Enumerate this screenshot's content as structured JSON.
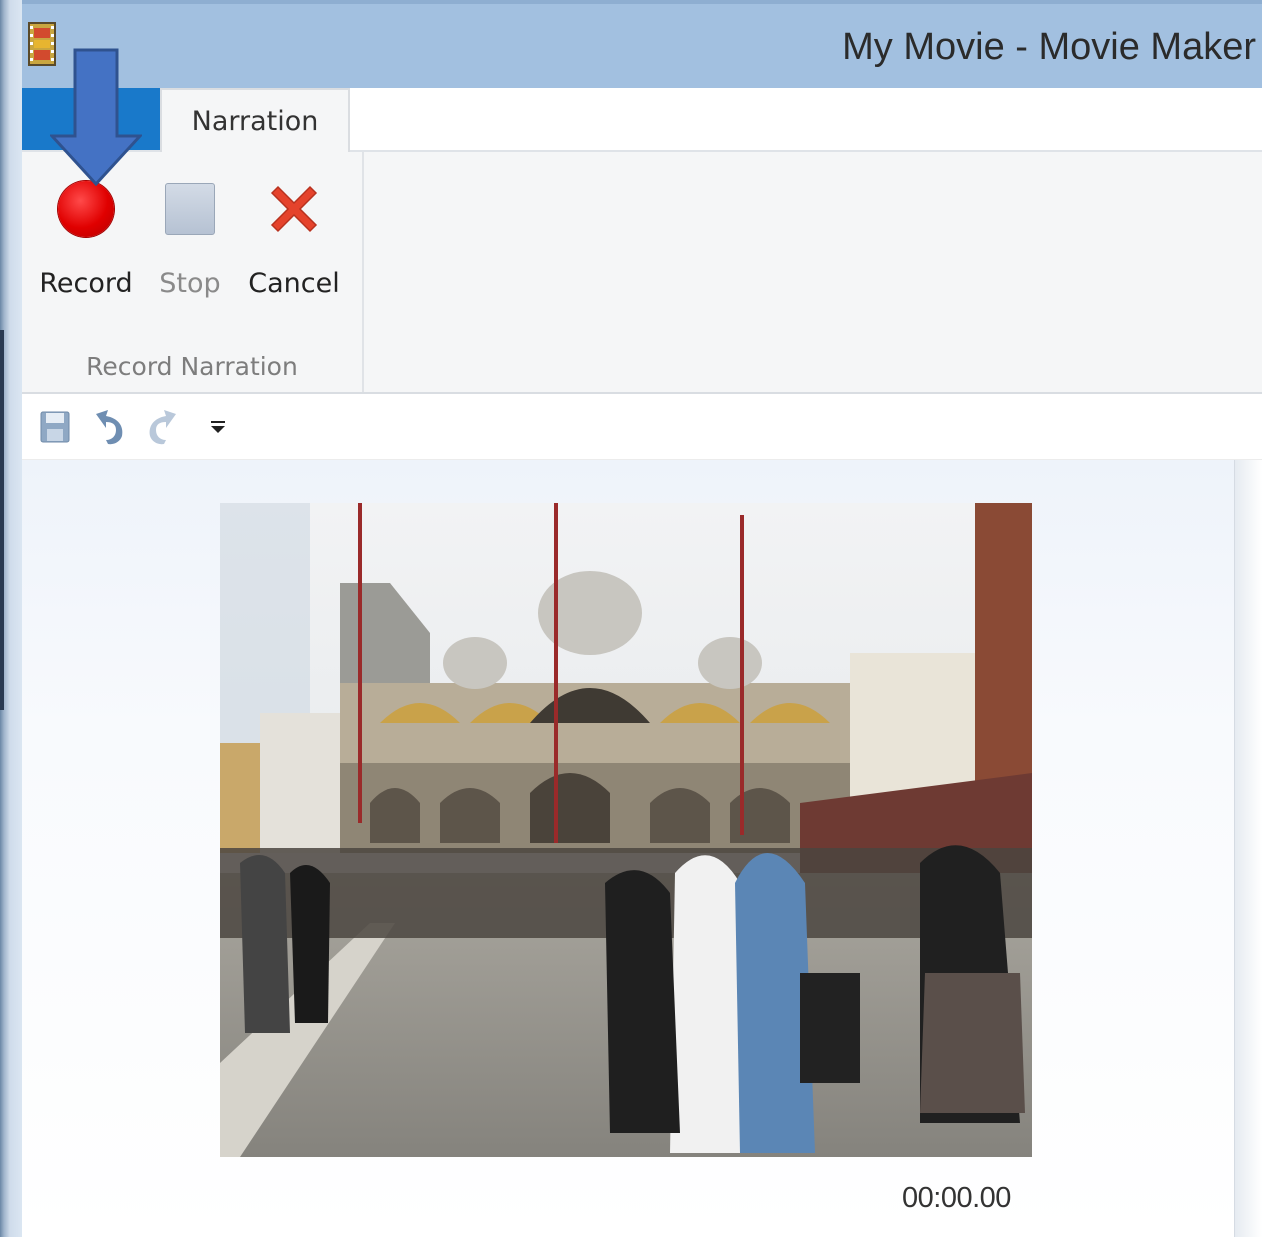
{
  "window": {
    "title": "My Movie - Movie Maker"
  },
  "tabs": {
    "active_label": "Narration"
  },
  "ribbon": {
    "record_label": "Record",
    "stop_label": "Stop",
    "cancel_label": "Cancel",
    "group_label": "Record Narration"
  },
  "preview": {
    "timecode": "00:00.00"
  },
  "colors": {
    "title_bar": "#a2c0e0",
    "file_tab": "#1979ca",
    "record_red": "#e00000",
    "cancel_red": "#e5432c",
    "annotation_arrow": "#4472c4"
  },
  "icons": [
    "film-app-icon",
    "record-icon",
    "stop-icon",
    "cancel-icon",
    "save-icon",
    "undo-icon",
    "redo-icon",
    "customize-dropdown-icon",
    "down-arrow-annotation"
  ]
}
